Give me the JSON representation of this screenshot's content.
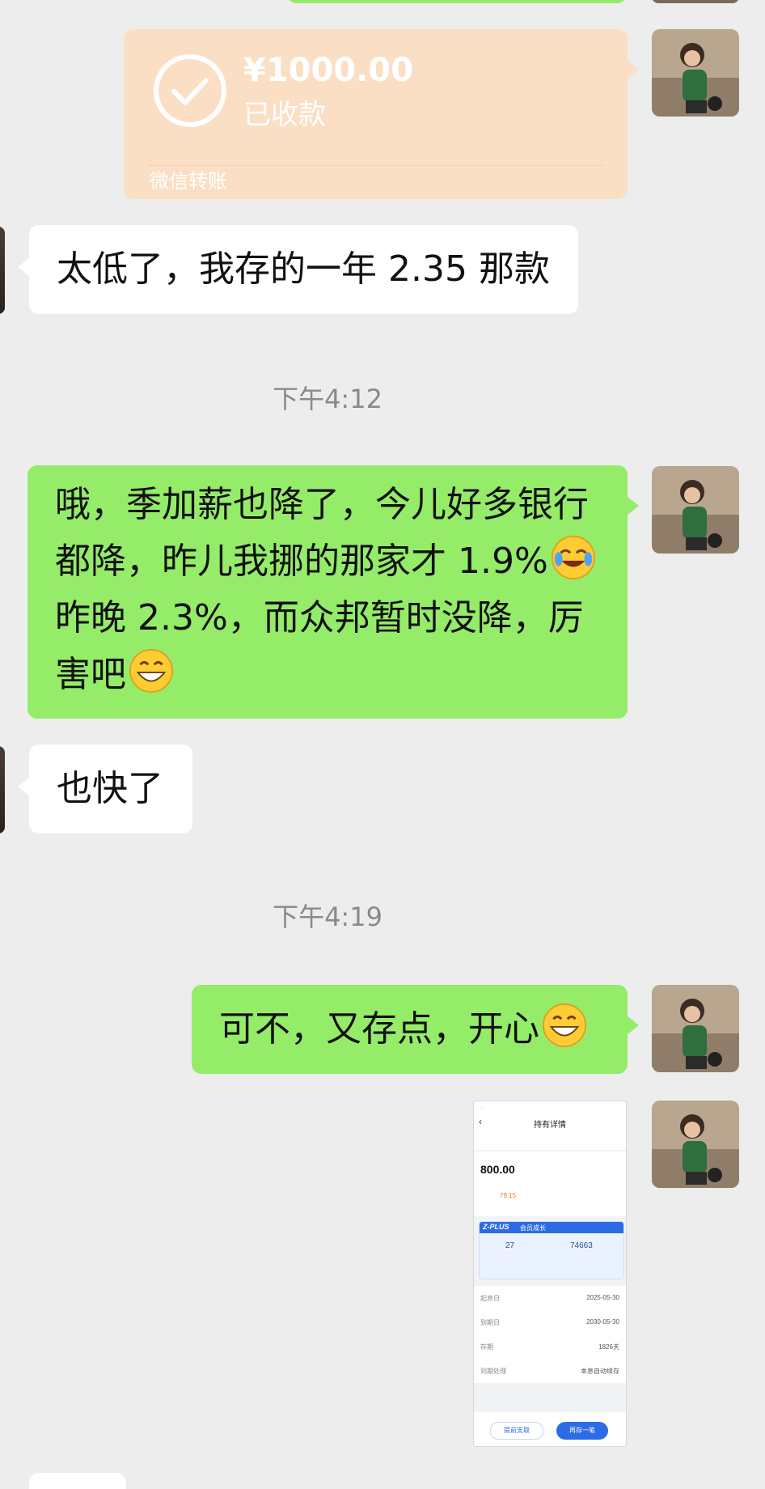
{
  "transfer": {
    "amount": "¥1000.00",
    "status": "已收款",
    "footer": "微信转账",
    "icon": "check-circle-icon"
  },
  "messages": {
    "m1": "太低了，我存的一年 2.35 那款",
    "ts1": "下午4:12",
    "m2_lines": [
      "哦，季加薪也降了，今儿好多银行",
      "都降，昨儿我挪的那家才 1.9%",
      "昨晚 2.3%，而众邦暂时没降，厉",
      "害吧"
    ],
    "m3": "也快了",
    "ts2": "下午4:19",
    "m4": "可不，又存点，开心"
  },
  "emojis": {
    "tears_of_joy": "laugh-cry-emoji",
    "grin": "grinning-emoji"
  },
  "screenshot": {
    "title": "持有详情",
    "principal": "800.00",
    "stat_value": "79.15",
    "banner_brand": "Z-PLUS",
    "banner_title": "会员成长",
    "stat_left": "27",
    "stat_right": "74663",
    "rows": [
      {
        "label": "起息日",
        "value": "2025-05-30"
      },
      {
        "label": "到期日",
        "value": "2030-05-30"
      },
      {
        "label": "存期",
        "value": "1826天"
      },
      {
        "label": "到期处理",
        "value": "本息自动续存"
      }
    ],
    "btn_secondary": "提前支取",
    "btn_primary": "再存一笔"
  },
  "colors": {
    "chat_bg": "#ededed",
    "green_bubble": "#95ec69",
    "transfer_bg": "#fbdfc4",
    "timestamp": "#8a8a8a"
  }
}
